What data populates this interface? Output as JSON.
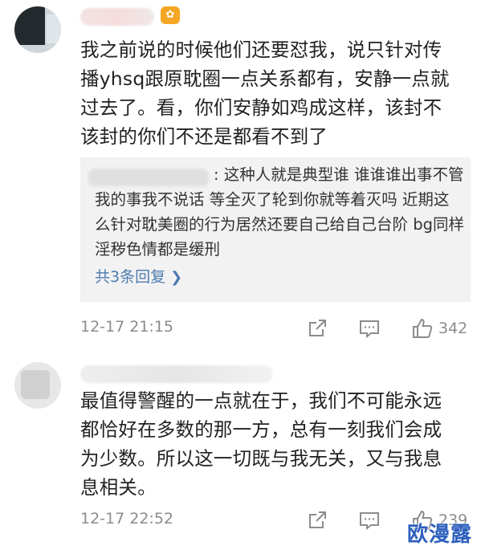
{
  "comments": [
    {
      "text": "我之前说的时候他们还要怼我，说只针对传播yhsq跟原耽圈一点关系都有，安静一点就过去了。看，你们安静如鸡成这样，该封不该封的你们不还是都看不到了",
      "reply": {
        "text": ": 这种人就是典型谁 谁谁谁出事不管我的事我不说话 等全灭了轮到你就等着灭吗 近期这么针对耽美圈的行为居然还要自己给自己台阶 bg同样淫秽色情都是缓刑",
        "more_label": "共3条回复"
      },
      "time": "12-17 21:15",
      "likes": "342"
    },
    {
      "text": "最值得警醒的一点就在于，我们不可能永远都恰好在多数的那一方，总有一刻我们会成为少数。所以这一切既与我无关，又与我息息相关。",
      "time": "12-17 22:52",
      "likes": "239"
    }
  ],
  "watermark": "欧漫露",
  "colors": {
    "link": "#4e7bb0",
    "meta": "#8c8c8c",
    "reply_bg": "#f2f2f2",
    "watermark": "#2d5fbd"
  },
  "icons": [
    "chevron-right-icon",
    "share-icon",
    "comment-icon",
    "like-icon"
  ]
}
